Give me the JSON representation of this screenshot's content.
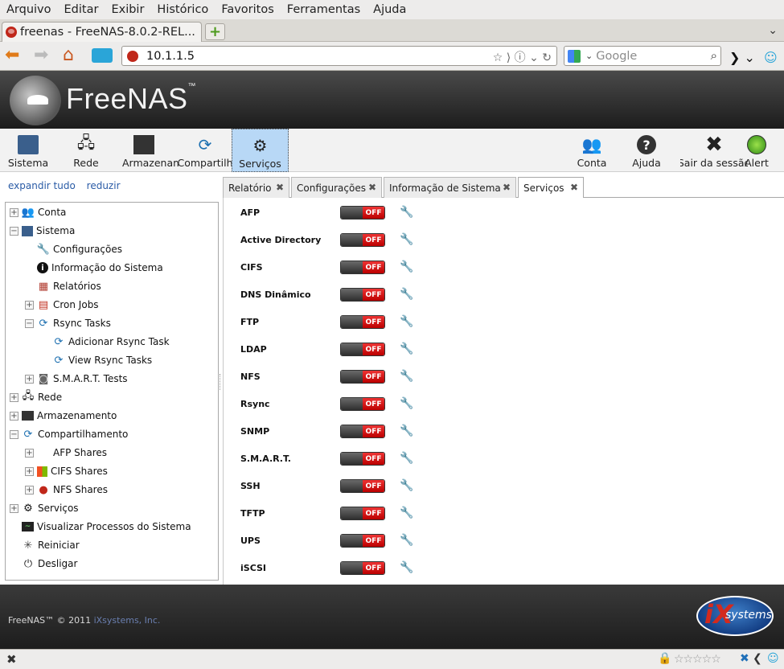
{
  "browser": {
    "menu": [
      "Arquivo",
      "Editar",
      "Exibir",
      "Histórico",
      "Favoritos",
      "Ferramentas",
      "Ajuda"
    ],
    "tab_title": "freenas - FreeNAS-8.0.2-REL...",
    "url": "10.1.1.5",
    "search_placeholder": "Google"
  },
  "app": {
    "logo_text": "FreeNAS",
    "toolbar": {
      "left": [
        "Sistema",
        "Rede",
        "Armazenamento",
        "Compartilh",
        "Serviços"
      ],
      "right": [
        "Conta",
        "Ajuda",
        "Sair da sessão",
        "Alert"
      ],
      "active": "Serviços"
    },
    "tree_links": {
      "expand": "expandir tudo",
      "collapse": "reduzir"
    },
    "tree": [
      {
        "label": "Conta"
      },
      {
        "label": "Sistema"
      },
      {
        "label": "Configurações"
      },
      {
        "label": "Informação do Sistema"
      },
      {
        "label": "Relatórios"
      },
      {
        "label": "Cron Jobs"
      },
      {
        "label": "Rsync Tasks"
      },
      {
        "label": "Adicionar Rsync Task"
      },
      {
        "label": "View Rsync Tasks"
      },
      {
        "label": "S.M.A.R.T. Tests"
      },
      {
        "label": "Rede"
      },
      {
        "label": "Armazenamento"
      },
      {
        "label": "Compartilhamento"
      },
      {
        "label": "AFP Shares"
      },
      {
        "label": "CIFS Shares"
      },
      {
        "label": "NFS Shares"
      },
      {
        "label": "Serviços"
      },
      {
        "label": "Visualizar Processos do Sistema"
      },
      {
        "label": "Reiniciar"
      },
      {
        "label": "Desligar"
      }
    ],
    "tabs": [
      "Relatório",
      "Configurações",
      "Informação de Sistema",
      "Serviços"
    ],
    "active_tab": "Serviços",
    "services": [
      {
        "name": "AFP",
        "state": "OFF"
      },
      {
        "name": "Active Directory",
        "state": "OFF"
      },
      {
        "name": "CIFS",
        "state": "OFF"
      },
      {
        "name": "DNS Dinâmico",
        "state": "OFF"
      },
      {
        "name": "FTP",
        "state": "OFF"
      },
      {
        "name": "LDAP",
        "state": "OFF"
      },
      {
        "name": "NFS",
        "state": "OFF"
      },
      {
        "name": "Rsync",
        "state": "OFF"
      },
      {
        "name": "SNMP",
        "state": "OFF"
      },
      {
        "name": "S.M.A.R.T.",
        "state": "OFF"
      },
      {
        "name": "SSH",
        "state": "OFF"
      },
      {
        "name": "TFTP",
        "state": "OFF"
      },
      {
        "name": "UPS",
        "state": "OFF"
      },
      {
        "name": "iSCSI",
        "state": "OFF"
      }
    ],
    "footer": {
      "copyright": "FreeNAS™ © 2011",
      "company": "iXsystems, Inc.",
      "ix_logo": "systems"
    }
  }
}
